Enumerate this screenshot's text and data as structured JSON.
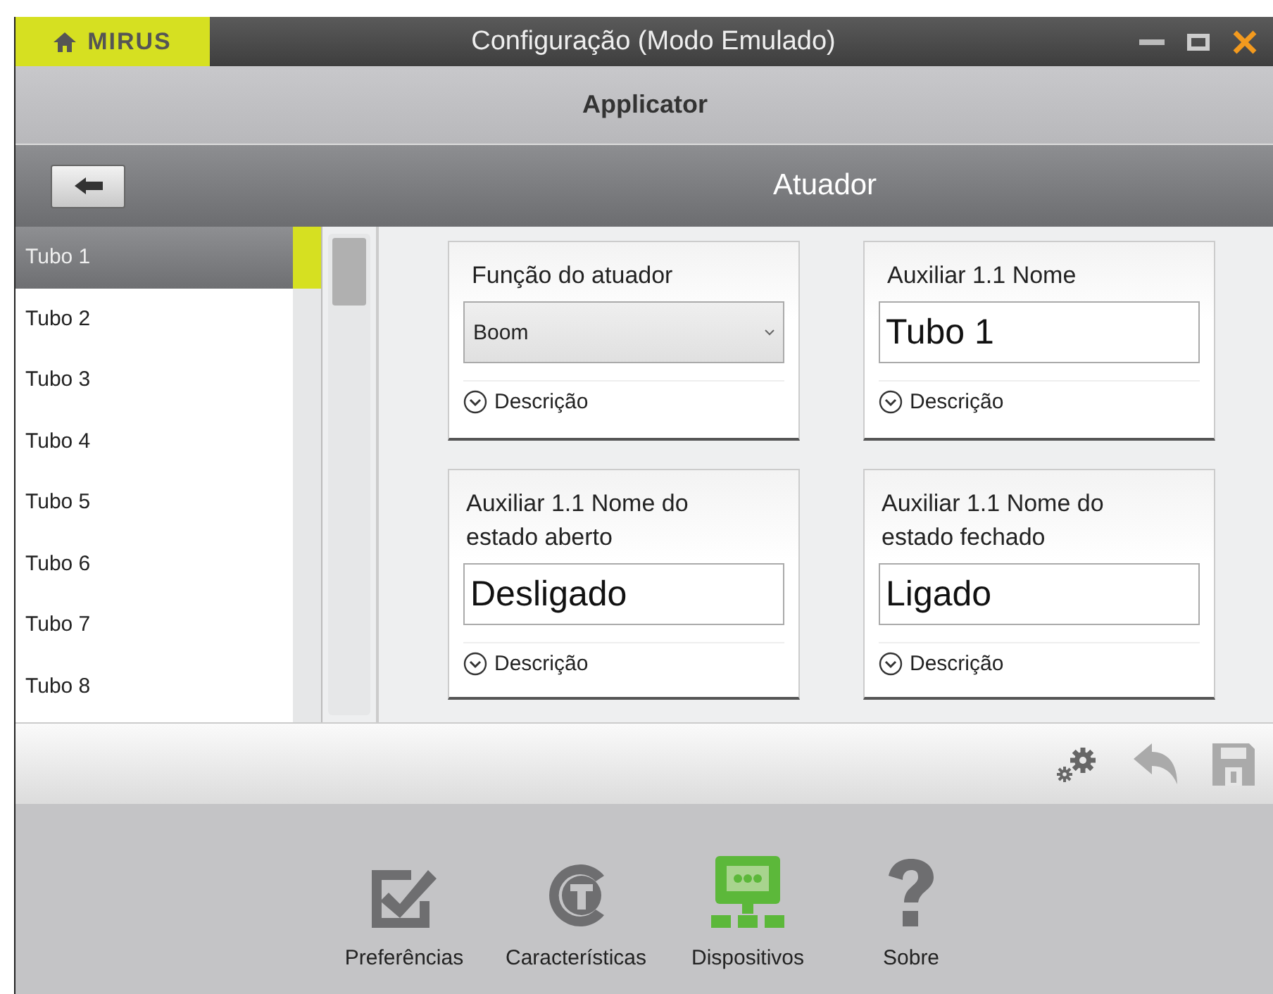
{
  "window": {
    "logo": "MIRUS",
    "title": "Configuração (Modo Emulado)"
  },
  "header": {
    "title": "Applicator"
  },
  "subheader": {
    "title": "Atuador"
  },
  "sidebar": {
    "items": [
      {
        "label": "Tubo 1",
        "selected": true
      },
      {
        "label": "Tubo 2",
        "selected": false
      },
      {
        "label": "Tubo 3",
        "selected": false
      },
      {
        "label": "Tubo 4",
        "selected": false
      },
      {
        "label": "Tubo 5",
        "selected": false
      },
      {
        "label": "Tubo 6",
        "selected": false
      },
      {
        "label": "Tubo 7",
        "selected": false
      },
      {
        "label": "Tubo 8",
        "selected": false
      }
    ]
  },
  "cards": [
    {
      "label": "Função do atuador",
      "kind": "select",
      "value": "Boom",
      "description": "Descrição"
    },
    {
      "label": "Auxiliar 1.1 Nome",
      "kind": "text",
      "value": "Tubo 1",
      "description": "Descrição"
    },
    {
      "label": "Auxiliar 1.1 Nome do estado aberto",
      "kind": "text",
      "value": "Desligado",
      "description": "Descrição"
    },
    {
      "label": "Auxiliar 1.1 Nome do estado fechado",
      "kind": "text",
      "value": "Ligado",
      "description": "Descrição"
    }
  ],
  "nav": [
    {
      "label": "Preferências",
      "selected": false
    },
    {
      "label": "Características",
      "selected": false
    },
    {
      "label": "Dispositivos",
      "selected": true
    },
    {
      "label": "Sobre",
      "selected": false
    }
  ]
}
